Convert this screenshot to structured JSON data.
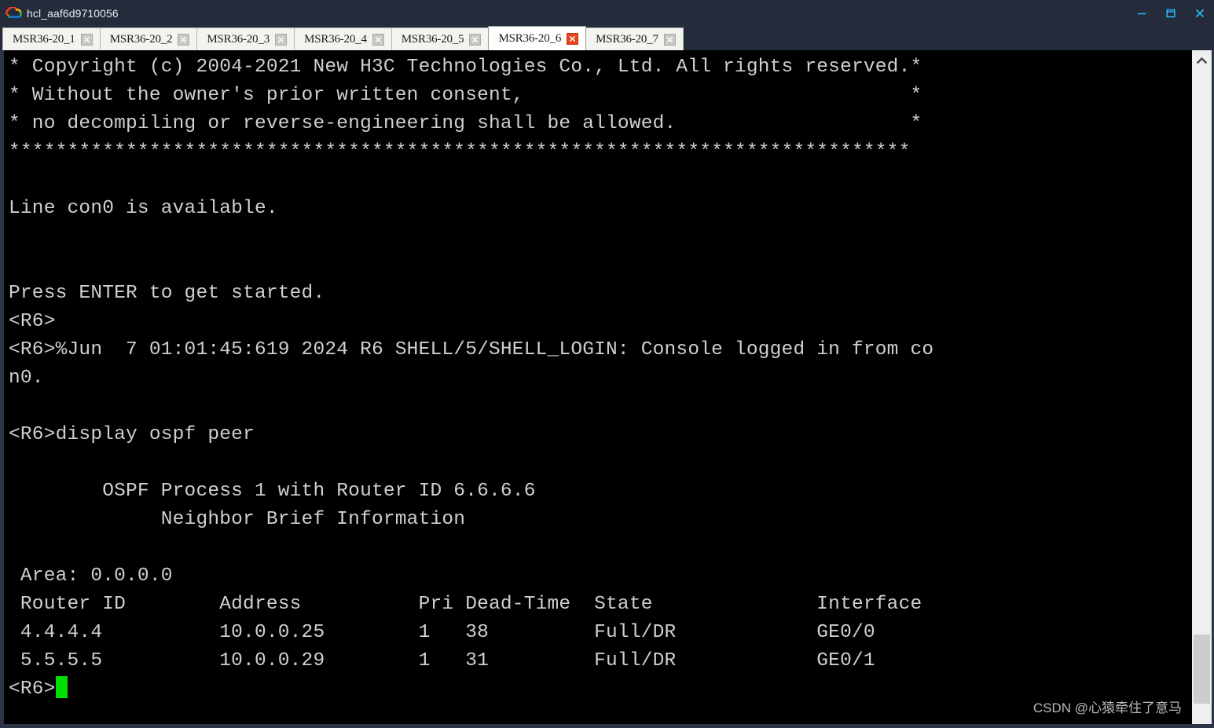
{
  "window": {
    "title": "hcl_aaf6d9710056",
    "app_icon": "cloud-icon",
    "controls": {
      "minimize": "minimize-icon",
      "maximize": "maximize-icon",
      "close": "close-icon"
    },
    "accent_color": "#29b6f6",
    "titlebar_color": "#242b3a"
  },
  "tabs": [
    {
      "label": "MSR36-20_1",
      "active": false,
      "close_icon": "close-icon"
    },
    {
      "label": "MSR36-20_2",
      "active": false,
      "close_icon": "close-icon"
    },
    {
      "label": "MSR36-20_3",
      "active": false,
      "close_icon": "close-icon"
    },
    {
      "label": "MSR36-20_4",
      "active": false,
      "close_icon": "close-icon"
    },
    {
      "label": "MSR36-20_5",
      "active": false,
      "close_icon": "close-icon"
    },
    {
      "label": "MSR36-20_6",
      "active": true,
      "close_icon": "close-icon"
    },
    {
      "label": "MSR36-20_7",
      "active": false,
      "close_icon": "close-icon"
    }
  ],
  "terminal": {
    "background": "#000000",
    "foreground": "#cfcfcf",
    "cursor_color": "#00e000",
    "prompt": "<R6>",
    "lines": [
      "* Copyright (c) 2004-2021 New H3C Technologies Co., Ltd. All rights reserved.*",
      "* Without the owner's prior written consent,                                 *",
      "* no decompiling or reverse-engineering shall be allowed.                    *",
      "*****************************************************************************",
      "",
      "Line con0 is available.",
      "",
      "",
      "Press ENTER to get started.",
      "<R6>",
      "<R6>%Jun  7 01:01:45:619 2024 R6 SHELL/5/SHELL_LOGIN: Console logged in from co",
      "n0.",
      "",
      "<R6>display ospf peer",
      "",
      "        OSPF Process 1 with Router ID 6.6.6.6",
      "             Neighbor Brief Information",
      "",
      " Area: 0.0.0.0",
      " Router ID        Address          Pri Dead-Time  State              Interface",
      " 4.4.4.4          10.0.0.25        1   38         Full/DR            GE0/0",
      " 5.5.5.5          10.0.0.29        1   31         Full/DR            GE0/1"
    ],
    "command": "display ospf peer",
    "ospf": {
      "process_header": "OSPF Process 1 with Router ID 6.6.6.6",
      "subheader": "Neighbor Brief Information",
      "process_id": "1",
      "router_id": "6.6.6.6",
      "area": "0.0.0.0",
      "area_label": "Area:",
      "columns": [
        "Router ID",
        "Address",
        "Pri",
        "Dead-Time",
        "State",
        "Interface"
      ],
      "rows": [
        {
          "router_id": "4.4.4.4",
          "address": "10.0.0.25",
          "pri": "1",
          "dead_time": "38",
          "state": "Full/DR",
          "interface": "GE0/0"
        },
        {
          "router_id": "5.5.5.5",
          "address": "10.0.0.29",
          "pri": "1",
          "dead_time": "31",
          "state": "Full/DR",
          "interface": "GE0/1"
        }
      ]
    }
  },
  "scrollbar": {
    "up_arrow": "chevron-up-icon",
    "thumb_position": "bottom"
  },
  "watermark": {
    "text": "CSDN @心猿牵住了意马"
  }
}
